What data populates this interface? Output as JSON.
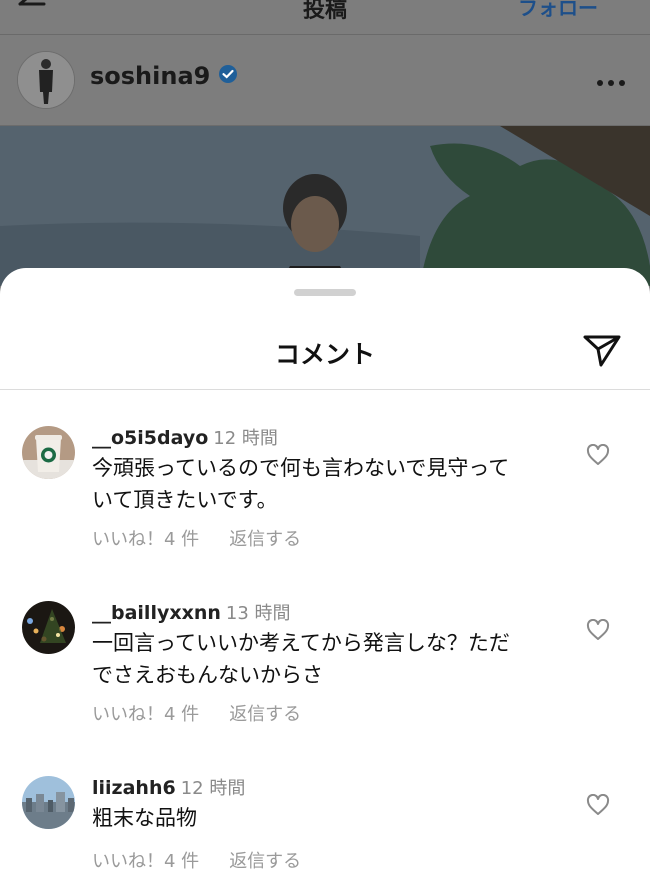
{
  "nav": {
    "title": "投稿",
    "follow_label": "フォロー"
  },
  "post": {
    "username": "soshina9",
    "verified": true
  },
  "sheet": {
    "title": "コメント"
  },
  "comments": [
    {
      "username": "__o5i5dayo",
      "time": "12 時間",
      "text_lines": [
        "今頑張っているので何も言わないで見守って",
        "いて頂きたいです。"
      ],
      "likes_label": "いいね！4 件",
      "reply_label": "返信する",
      "avatar": "starbucks-cup"
    },
    {
      "username": "__baillyxxnn",
      "time": "13 時間",
      "text_lines": [
        "一回言っていいか考えてから発言しな？ただ",
        "でさえおもんないからさ"
      ],
      "likes_label": "いいね！4 件",
      "reply_label": "返信する",
      "avatar": "night-lights"
    },
    {
      "username": "liizahh6",
      "time": "12 時間",
      "text_lines": [
        "粗末な品物"
      ],
      "likes_label": "いいね！4 件",
      "reply_label": "返信する",
      "avatar": "city-sky"
    }
  ],
  "colors": {
    "verified": "#1f6fb5",
    "muted": "#8a8a8a",
    "sheet_bg": "#ffffff"
  }
}
